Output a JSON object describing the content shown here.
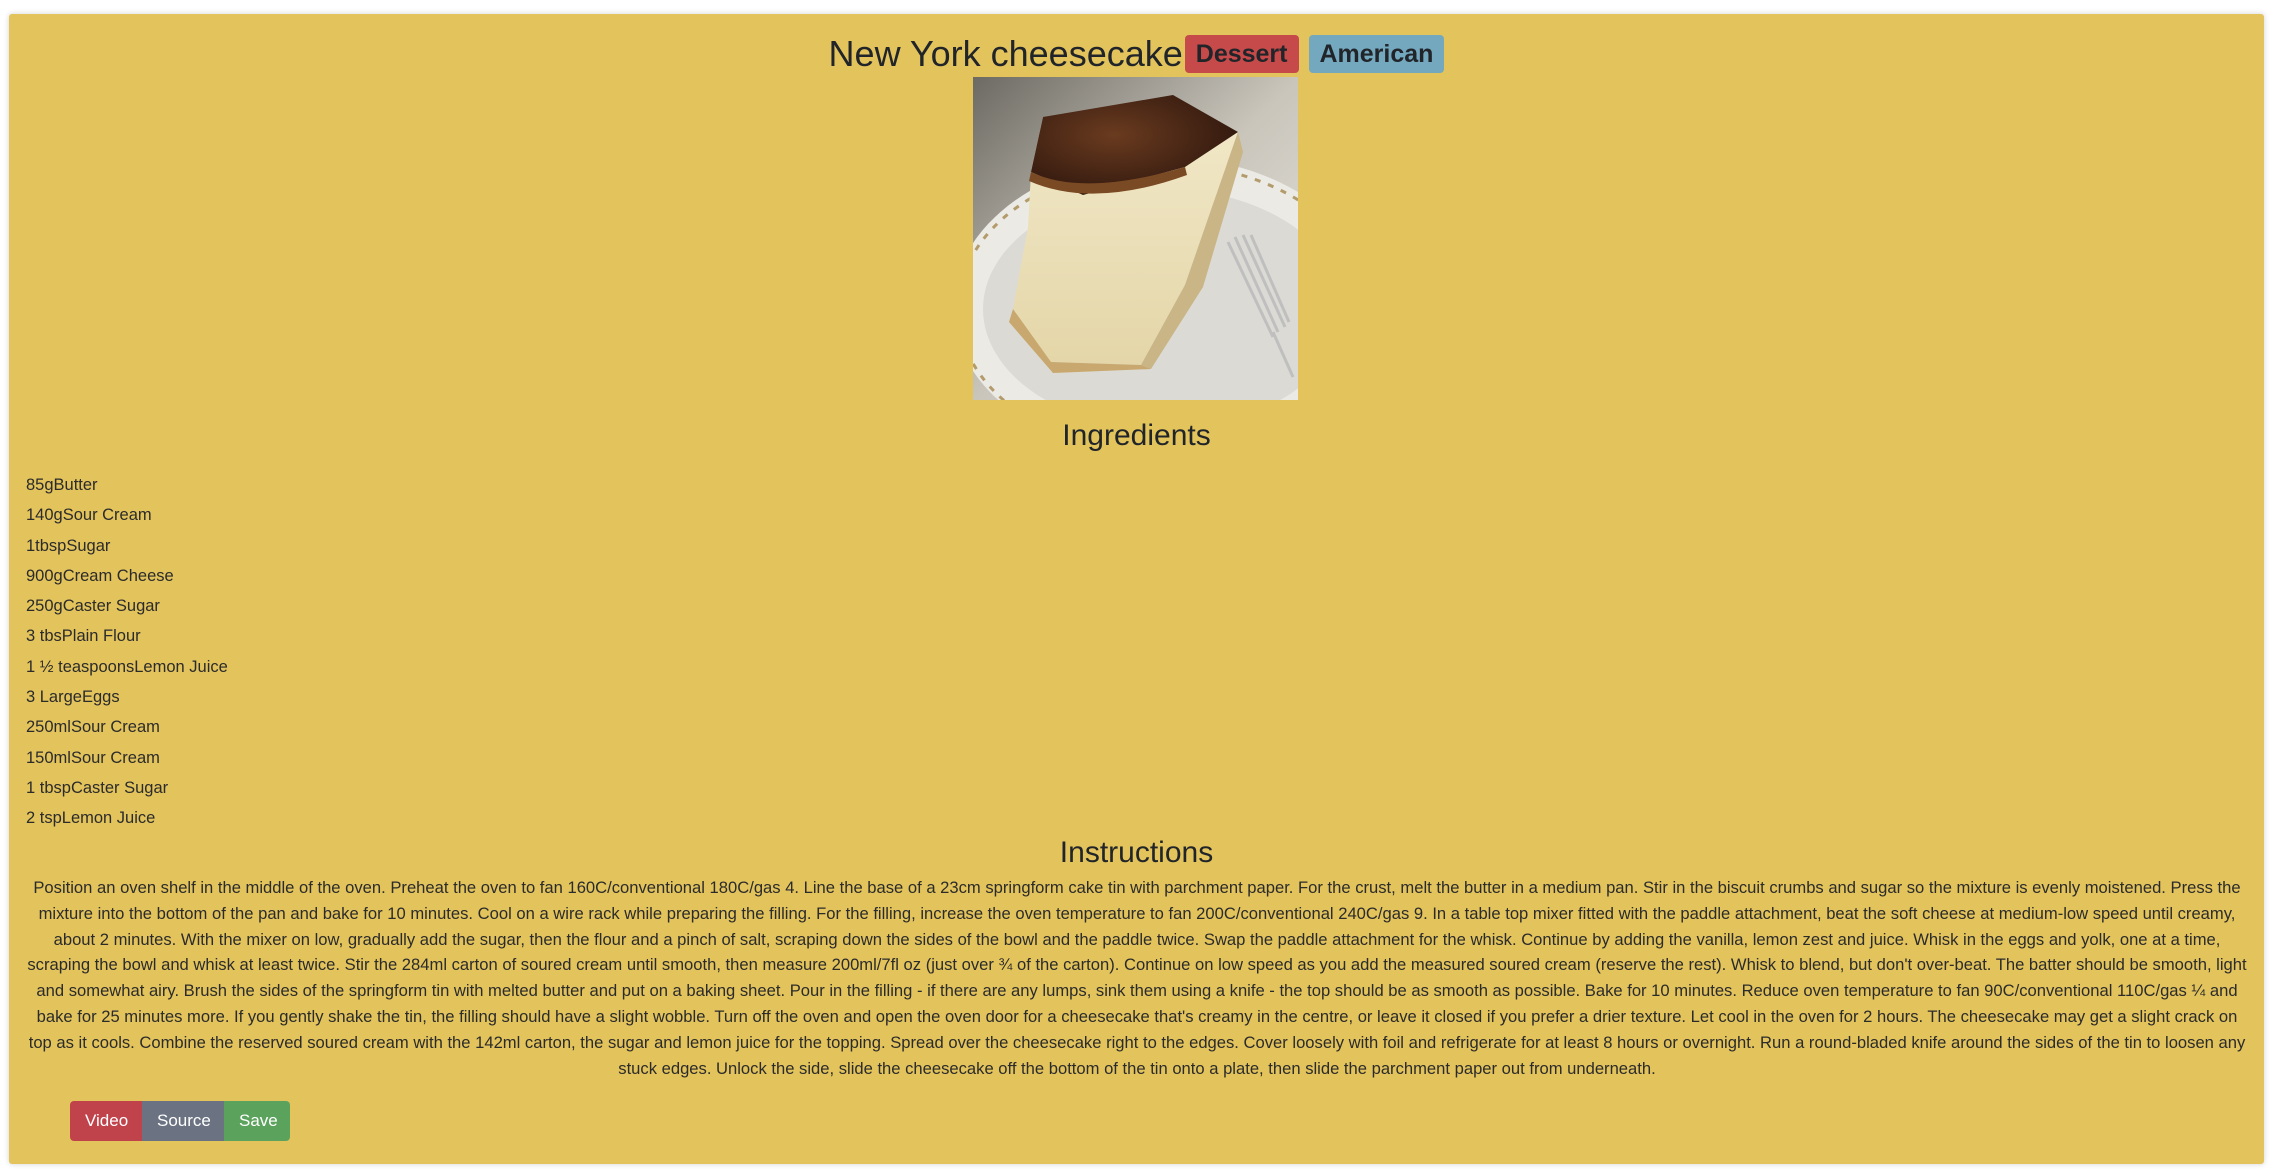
{
  "meal": {
    "title": "New York cheesecake",
    "category": "Dessert",
    "area": "American",
    "image_alt": "New York cheesecake"
  },
  "ingredients_heading": "Ingredients",
  "ingredients": [
    "85gButter",
    "140gSour Cream",
    "1tbspSugar",
    "900gCream Cheese",
    "250gCaster Sugar",
    "3 tbsPlain Flour",
    "1 ½ teaspoonsLemon Juice",
    "3 LargeEggs",
    "250mlSour Cream",
    "150mlSour Cream",
    "1 tbspCaster Sugar",
    "2 tspLemon Juice"
  ],
  "instructions_heading": "Instructions",
  "instructions": "Position an oven shelf in the middle of the oven. Preheat the oven to fan 160C/conventional 180C/gas 4. Line the base of a 23cm springform cake tin with parchment paper. For the crust, melt the butter in a medium pan. Stir in the biscuit crumbs and sugar so the mixture is evenly moistened. Press the mixture into the bottom of the pan and bake for 10 minutes. Cool on a wire rack while preparing the filling. For the filling, increase the oven temperature to fan 200C/conventional 240C/gas 9. In a table top mixer fitted with the paddle attachment, beat the soft cheese at medium-low speed until creamy, about 2 minutes. With the mixer on low, gradually add the sugar, then the flour and a pinch of salt, scraping down the sides of the bowl and the paddle twice. Swap the paddle attachment for the whisk. Continue by adding the vanilla, lemon zest and juice. Whisk in the eggs and yolk, one at a time, scraping the bowl and whisk at least twice. Stir the 284ml carton of soured cream until smooth, then measure 200ml/7fl oz (just over ¾ of the carton). Continue on low speed as you add the measured soured cream (reserve the rest). Whisk to blend, but don't over-beat. The batter should be smooth, light and somewhat airy. Brush the sides of the springform tin with melted butter and put on a baking sheet. Pour in the filling - if there are any lumps, sink them using a knife - the top should be as smooth as possible. Bake for 10 minutes. Reduce oven temperature to fan 90C/conventional 110C/gas ¼ and bake for 25 minutes more. If you gently shake the tin, the filling should have a slight wobble. Turn off the oven and open the oven door for a cheesecake that's creamy in the centre, or leave it closed if you prefer a drier texture. Let cool in the oven for 2 hours. The cheesecake may get a slight crack on top as it cools. Combine the reserved soured cream with the 142ml carton, the sugar and lemon juice for the topping. Spread over the cheesecake right to the edges. Cover loosely with foil and refrigerate for at least 8 hours or overnight. Run a round-bladed knife around the sides of the tin to loosen any stuck edges. Unlock the side, slide the cheesecake off the bottom of the tin onto a plate, then slide the parchment paper out from underneath.",
  "actions": {
    "video_label": "Video",
    "source_label": "Source",
    "save_label": "Save"
  },
  "colors": {
    "card_background": "#e3c35c",
    "category_badge": "#c64a4a",
    "area_badge": "#73a8bf",
    "video_button": "#c0434c",
    "source_button": "#6b7383",
    "save_button": "#5ba35d"
  }
}
